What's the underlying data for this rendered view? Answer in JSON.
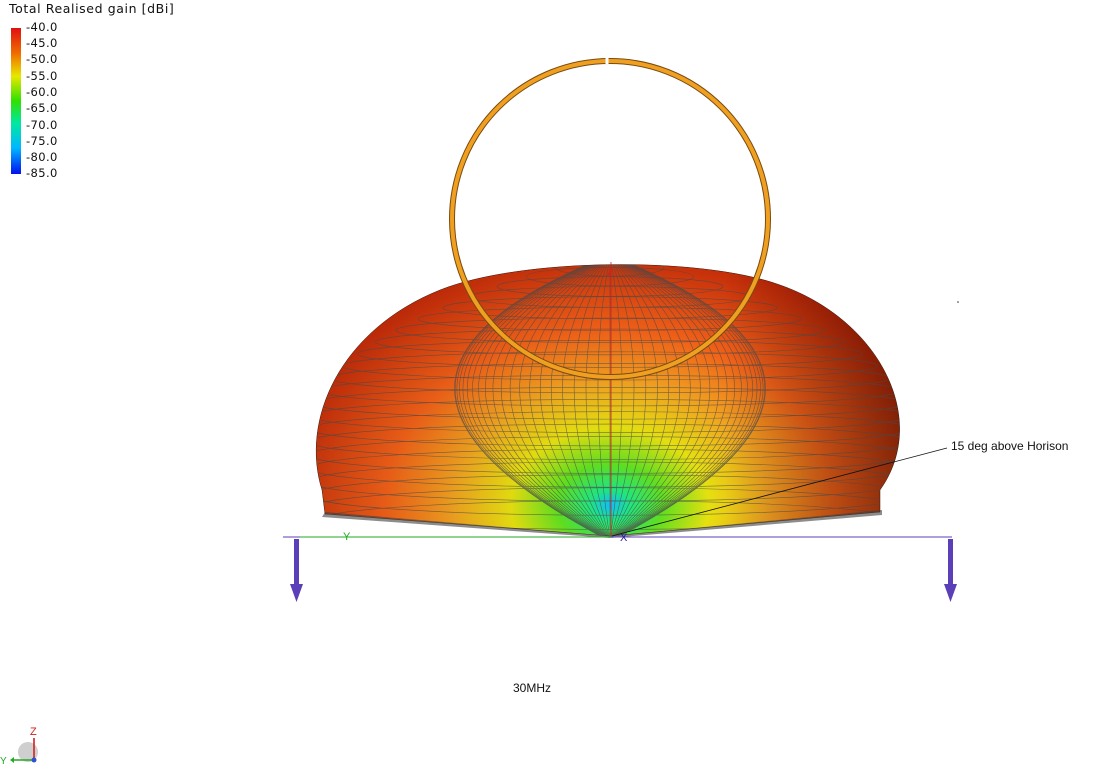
{
  "legend": {
    "title": "Total Realised gain [dBi]",
    "ticks": [
      "-40.0",
      "-45.0",
      "-50.0",
      "-55.0",
      "-60.0",
      "-65.0",
      "-70.0",
      "-75.0",
      "-80.0",
      "-85.0"
    ]
  },
  "annotation": "15 deg above Horison",
  "frequency": "30MHz",
  "axis_labels": {
    "y": "Y",
    "x": "X",
    "z": "Z",
    "corner_y": "Y"
  },
  "colors": {
    "loop": "#f0a020",
    "ground": "#5b3fb8",
    "axis_y": "#22aa22",
    "axis_z": "#d02020"
  }
}
